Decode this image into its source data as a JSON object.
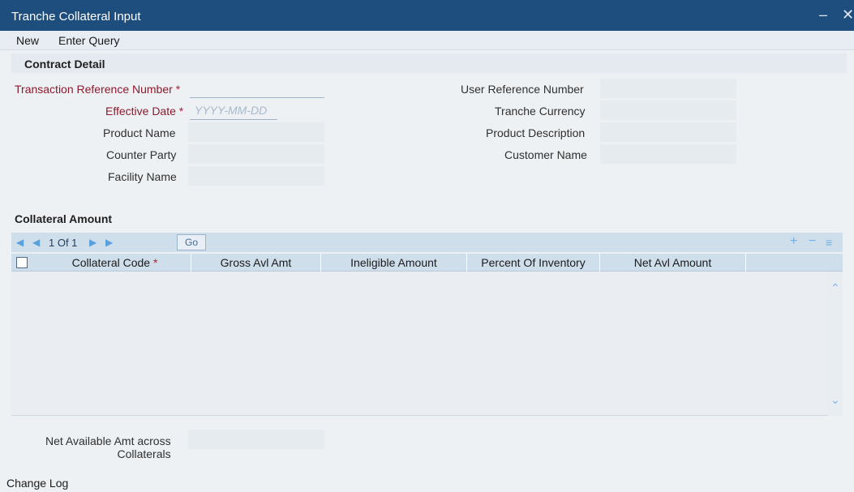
{
  "window": {
    "title": "Tranche Collateral Input",
    "minimize": "–",
    "close": "✕"
  },
  "menu": {
    "new": "New",
    "enter_query": "Enter Query"
  },
  "contract_detail": {
    "heading": "Contract Detail",
    "transaction_reference_number": {
      "label": "Transaction Reference Number",
      "value": ""
    },
    "effective_date": {
      "label": "Effective Date",
      "placeholder": "YYYY-MM-DD",
      "value": ""
    },
    "product_name": {
      "label": "Product Name",
      "value": ""
    },
    "counter_party": {
      "label": "Counter Party",
      "value": ""
    },
    "facility_name": {
      "label": "Facility Name",
      "value": ""
    },
    "user_reference_number": {
      "label": "User Reference Number",
      "value": ""
    },
    "tranche_currency": {
      "label": "Tranche Currency",
      "value": ""
    },
    "product_description": {
      "label": "Product Description",
      "value": ""
    },
    "customer_name": {
      "label": "Customer Name",
      "value": ""
    },
    "required_mark": "*"
  },
  "collateral_amount": {
    "heading": "Collateral Amount",
    "pagination": {
      "text": "1 Of 1",
      "go": "Go"
    },
    "columns": [
      "Collateral Code",
      "Gross Avl Amt",
      "Ineligible Amount",
      "Percent Of Inventory",
      "Net Avl Amount"
    ],
    "required_mark": "*",
    "rows": []
  },
  "net_available": {
    "label_line1": "Net Available Amt across",
    "label_line2": "Collaterals",
    "value": ""
  },
  "footer": {
    "change_log": "Change Log"
  }
}
